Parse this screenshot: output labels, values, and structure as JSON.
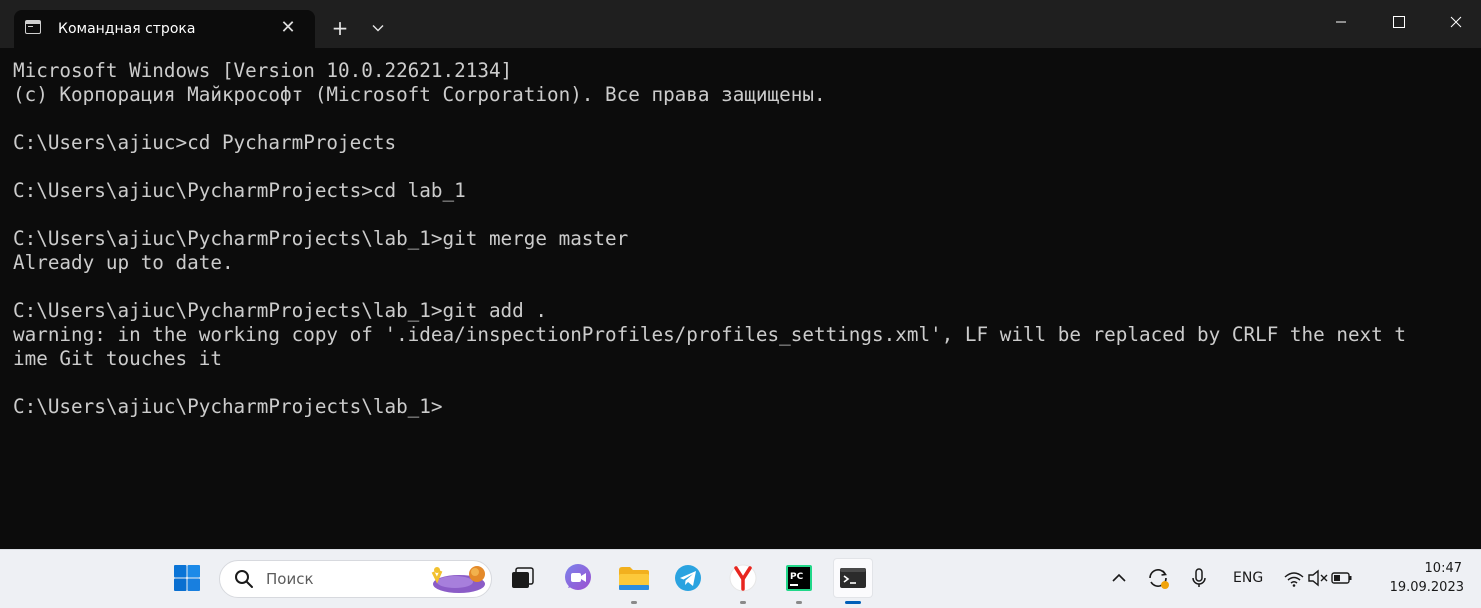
{
  "window": {
    "tab_title": "Командная строка",
    "tab_icon": "cmd-icon",
    "new_tab_symbol": "+",
    "close_tab_symbol": "✕"
  },
  "terminal": {
    "lines": [
      "Microsoft Windows [Version 10.0.22621.2134]",
      "(c) Корпорация Майкрософт (Microsoft Corporation). Все права защищены.",
      "",
      "C:\\Users\\ajiuc>cd PycharmProjects",
      "",
      "C:\\Users\\ajiuc\\PycharmProjects>cd lab_1",
      "",
      "C:\\Users\\ajiuc\\PycharmProjects\\lab_1>git merge master",
      "Already up to date.",
      "",
      "C:\\Users\\ajiuc\\PycharmProjects\\lab_1>git add .",
      "warning: in the working copy of '.idea/inspectionProfiles/profiles_settings.xml', LF will be replaced by CRLF the next t",
      "ime Git touches it",
      "",
      "C:\\Users\\ajiuc\\PycharmProjects\\lab_1>"
    ],
    "colors": {
      "background": "#0c0c0c",
      "text": "#cccccc"
    }
  },
  "taskbar": {
    "search_placeholder": "Поиск",
    "apps": [
      "windows-start-icon",
      "task-view-icon",
      "teams-chat-icon",
      "file-explorer-icon",
      "telegram-icon",
      "yandex-browser-icon",
      "pycharm-icon",
      "terminal-icon"
    ],
    "tray": {
      "language": "ENG",
      "time": "10:47",
      "date": "19.09.2023"
    },
    "accent": "#005fb8"
  }
}
